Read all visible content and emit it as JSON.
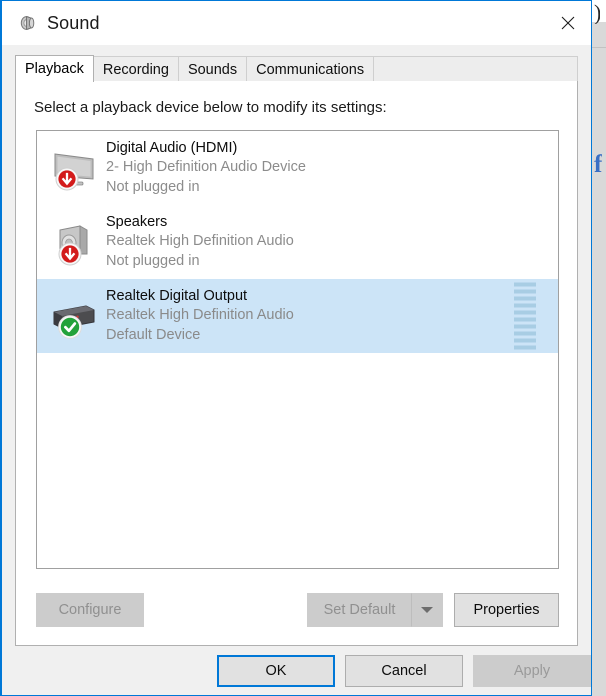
{
  "window": {
    "title": "Sound",
    "title_icon": "speaker-icon",
    "close_icon": "close-icon",
    "accent_color": "#0078d7",
    "selection_color": "#cce4f7"
  },
  "background": {
    "top_glyph": ")",
    "link_glyph": "f"
  },
  "tabs": [
    {
      "label": "Playback",
      "active": true
    },
    {
      "label": "Recording",
      "active": false
    },
    {
      "label": "Sounds",
      "active": false
    },
    {
      "label": "Communications",
      "active": false
    }
  ],
  "playback": {
    "instruction": "Select a playback device below to modify its settings:",
    "devices": [
      {
        "name": "Digital Audio (HDMI)",
        "description": "2- High Definition Audio Device",
        "status": "Not plugged in",
        "icon": "monitor-icon",
        "badge": "red-down-arrow-badge",
        "selected": false,
        "meter_visible": false,
        "meter_segments": 0
      },
      {
        "name": "Speakers",
        "description": "Realtek High Definition Audio",
        "status": "Not plugged in",
        "icon": "speaker-box-icon",
        "badge": "red-down-arrow-badge",
        "selected": false,
        "meter_visible": false,
        "meter_segments": 0
      },
      {
        "name": "Realtek Digital Output",
        "description": "Realtek High Definition Audio",
        "status": "Default Device",
        "icon": "digital-output-icon",
        "badge": "green-check-badge",
        "selected": true,
        "meter_visible": true,
        "meter_segments": 10
      }
    ]
  },
  "action_buttons": {
    "configure": {
      "label": "Configure",
      "enabled": false
    },
    "set_default": {
      "label": "Set Default",
      "enabled": false,
      "has_dropdown": true
    },
    "properties": {
      "label": "Properties",
      "enabled": true
    }
  },
  "footer_buttons": {
    "ok": {
      "label": "OK",
      "enabled": true,
      "is_default": true
    },
    "cancel": {
      "label": "Cancel",
      "enabled": true,
      "is_default": false
    },
    "apply": {
      "label": "Apply",
      "enabled": false,
      "is_default": false
    }
  }
}
